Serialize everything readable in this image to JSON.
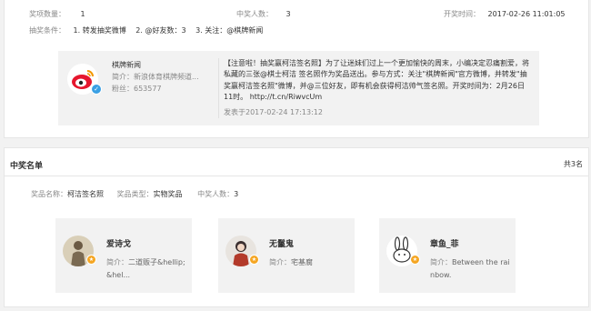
{
  "top": {
    "prize_count_label": "奖项数量：",
    "prize_count": "1",
    "winners_label": "中奖人数：",
    "winners": "3",
    "draw_time_label": "开奖时间：",
    "draw_time": "2017-02-26 11:01:05",
    "conditions_label": "抽奖条件：",
    "conditions": "1. 转发抽奖微博 　2. @好友数：3 　3. 关注：@棋牌新闻"
  },
  "weibo": {
    "user_name": "棋牌新闻",
    "intro": "简介：新浪体育棋牌频道...",
    "fans": "粉丝：653577",
    "content": "【注意啦！抽奖赢柯洁签名照】为了让迷妹们过上一个更加愉快的周末，小编决定忍痛割爱，将私藏的三张@棋士柯洁 签名照作为奖品送出。参与方式：关注\"棋牌新闻\"官方微博，并转发\"抽奖赢柯洁签名照\"微博，并@三位好友，即有机会获得柯洁帅气签名照。开奖时间为：2月26日11时。 http://t.cn/RiwvcUm",
    "posted": "发表于2017-02-24 17:13:12"
  },
  "winners_section": {
    "title": "中奖名单",
    "total": "共3名",
    "prize_name_label": "奖品名称：",
    "prize_name": "柯洁签名照",
    "prize_type_label": "奖品类型：",
    "prize_type": "实物奖品",
    "winner_count_label": "中奖人数：",
    "winner_count": "3",
    "winners": [
      {
        "name": "爱诗戈",
        "intro_label": "简介：",
        "intro": "二道贩子&hellip;&hel..."
      },
      {
        "name": "无鬣鬼",
        "intro_label": "简介：",
        "intro": "宅基腐"
      },
      {
        "name": "章鱼_菲",
        "intro_label": "简介：",
        "intro": "Between the rainbow."
      }
    ]
  },
  "colors": {
    "verified": "#3aa0e4",
    "badge": "#f5a623",
    "card_bg": "#f2f2f2"
  }
}
